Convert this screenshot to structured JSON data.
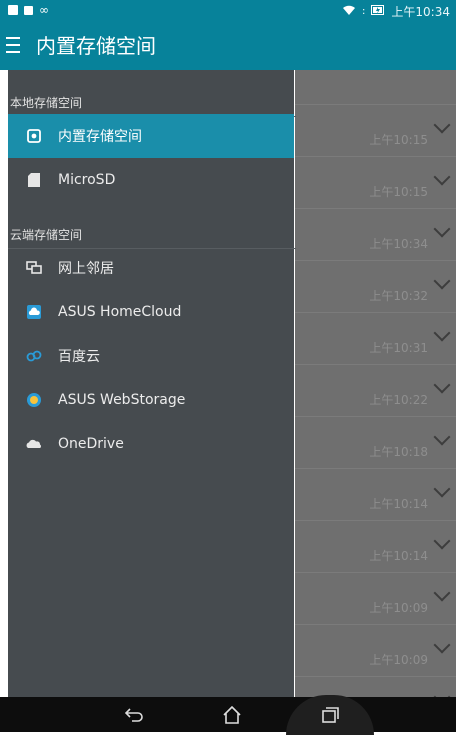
{
  "status_bar": {
    "time": "上午10:34",
    "left_icons": [
      "sd-card-icon",
      "image-icon",
      "infinity-icon"
    ],
    "infinity_glyph": "∞"
  },
  "app_bar": {
    "title": "内置存储空间"
  },
  "drawer": {
    "local_section_header": "本地存储空间",
    "local_items": [
      {
        "label": "内置存储空间",
        "icon": "internal-storage-icon",
        "selected": true
      },
      {
        "label": "MicroSD",
        "icon": "sd-card-icon",
        "selected": false
      }
    ],
    "cloud_section_header": "云端存储空间",
    "cloud_items": [
      {
        "label": "网上邻居",
        "icon": "network-neighborhood-icon"
      },
      {
        "label": "ASUS HomeCloud",
        "icon": "homecloud-icon"
      },
      {
        "label": "百度云",
        "icon": "baidu-cloud-icon"
      },
      {
        "label": "ASUS WebStorage",
        "icon": "webstorage-icon"
      },
      {
        "label": "OneDrive",
        "icon": "onedrive-icon"
      }
    ]
  },
  "background_list": {
    "times": [
      "上午10:15",
      "上午10:15",
      "上午10:34",
      "上午10:32",
      "上午10:31",
      "上午10:22",
      "上午10:18",
      "上午10:14",
      "上午10:14",
      "上午10:09",
      "上午10:09"
    ]
  },
  "nav_bar": {
    "buttons": [
      "back-icon",
      "home-icon",
      "recent-apps-icon"
    ]
  },
  "colors": {
    "accent": "#07829a",
    "drawer_bg": "#464b4f",
    "selected_bg": "#1a8eaa"
  }
}
